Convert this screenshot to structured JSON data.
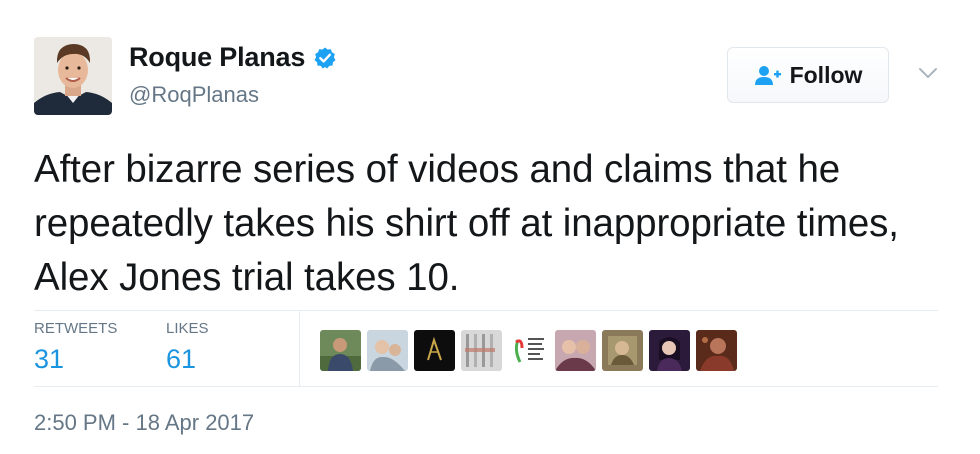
{
  "author": {
    "display_name": "Roque Planas",
    "handle": "@RoqPlanas",
    "verified": true
  },
  "follow_button": {
    "label": "Follow"
  },
  "tweet": {
    "text": "After bizarre series of videos and claims that he repeatedly takes his shirt off at inappropriate times, Alex Jones trial takes 10.",
    "timestamp": "2:50 PM - 18 Apr 2017"
  },
  "stats": {
    "retweets_label": "RETWEETS",
    "retweets_count": "31",
    "likes_label": "LIKES",
    "likes_count": "61"
  },
  "colors": {
    "link_blue": "#1b95e0",
    "verified_blue": "#1da1f2",
    "muted_gray": "#657786",
    "text_dark": "#14171a"
  },
  "icons": {
    "verified": "verified-badge-icon",
    "follow": "add-user-icon",
    "more": "chevron-down-icon"
  }
}
